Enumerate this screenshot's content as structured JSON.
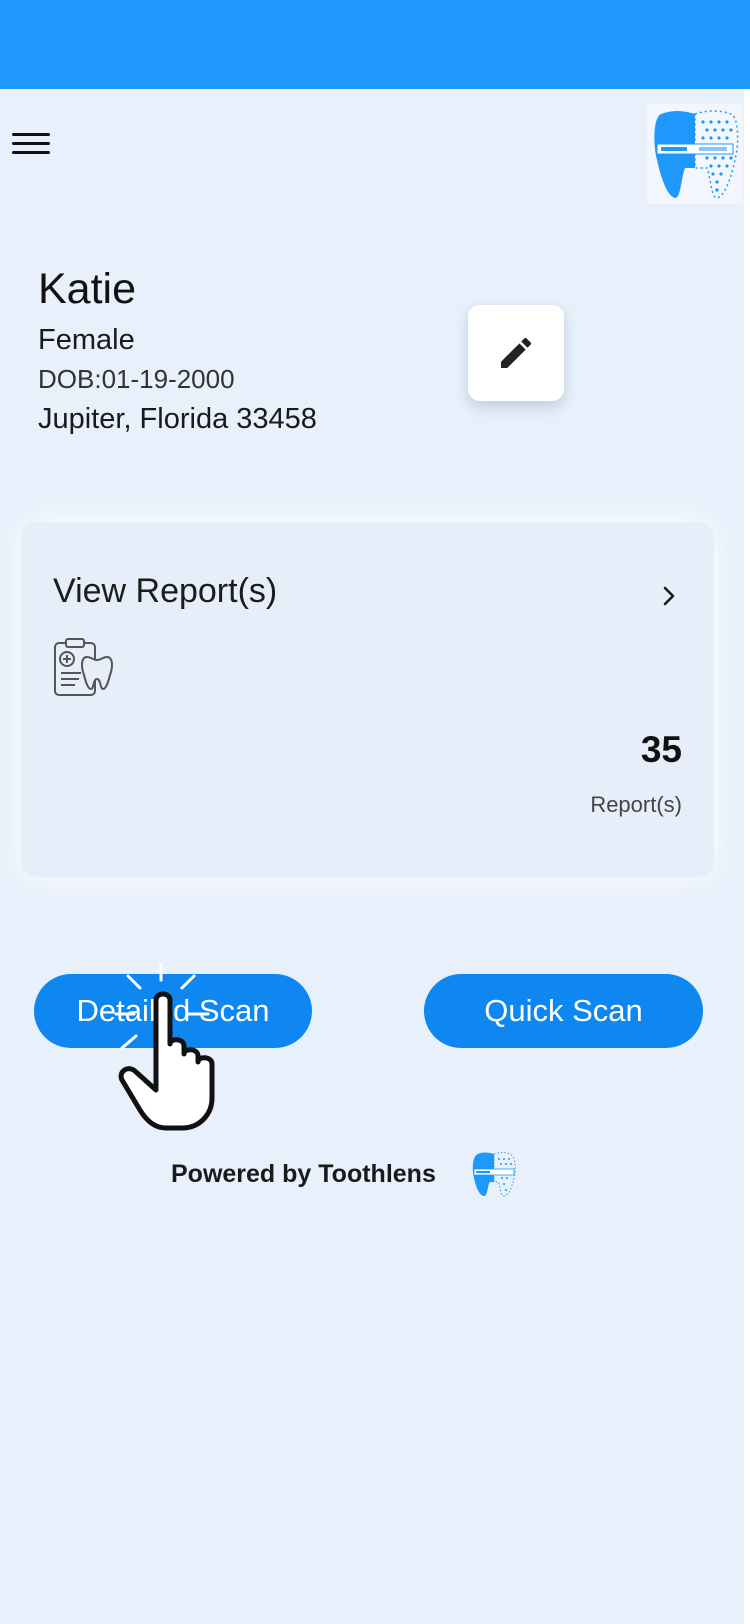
{
  "header": {
    "menu_icon": "hamburger-menu-icon",
    "logo_icon": "toothlens-logo-icon",
    "colors": {
      "status_bar": "#1e98fb"
    }
  },
  "profile": {
    "name": "Katie",
    "gender": "Female",
    "dob": "DOB:01-19-2000",
    "address": "Jupiter, Florida 33458",
    "edit_icon": "pencil-icon"
  },
  "reports_card": {
    "title": "View Report(s)",
    "icon": "tooth-report-icon",
    "chevron_icon": "chevron-right-icon",
    "count": "35",
    "count_label": "Report(s)"
  },
  "actions": {
    "detailed_scan": "Detailed Scan",
    "quick_scan": "Quick Scan",
    "button_color": "#0f87f0"
  },
  "overlay": {
    "pointer_icon": "tap-hand-icon"
  },
  "footer": {
    "powered_by": "Powered by Toothlens",
    "logo_icon": "toothlens-small-logo-icon"
  }
}
